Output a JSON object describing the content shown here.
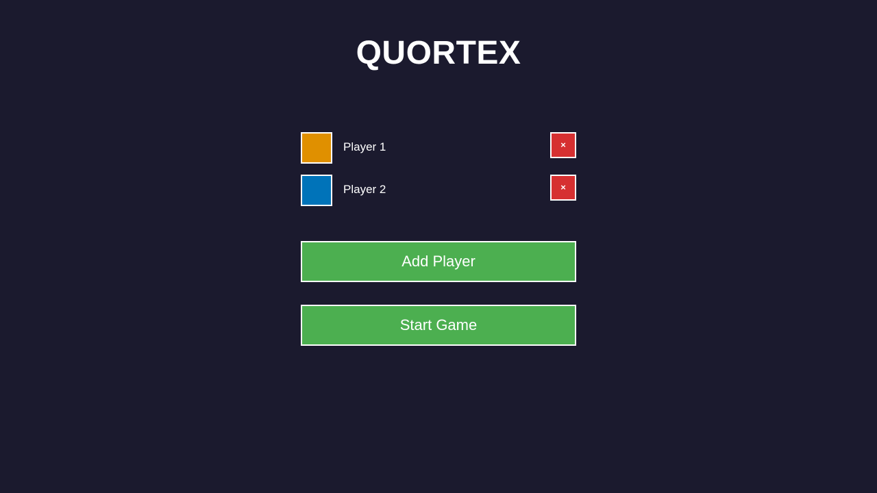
{
  "app": {
    "title": "QUORTEX"
  },
  "players": [
    {
      "name": "Player 1",
      "color": "#e09000",
      "remove_label": "×"
    },
    {
      "name": "Player 2",
      "color": "#0073b9",
      "remove_label": "×"
    }
  ],
  "actions": {
    "add_player_label": "Add Player",
    "start_game_label": "Start Game"
  },
  "colors": {
    "background": "#1b1a2e",
    "button_green": "#4caf50",
    "remove_red": "#d63031",
    "border": "#ffffff"
  }
}
